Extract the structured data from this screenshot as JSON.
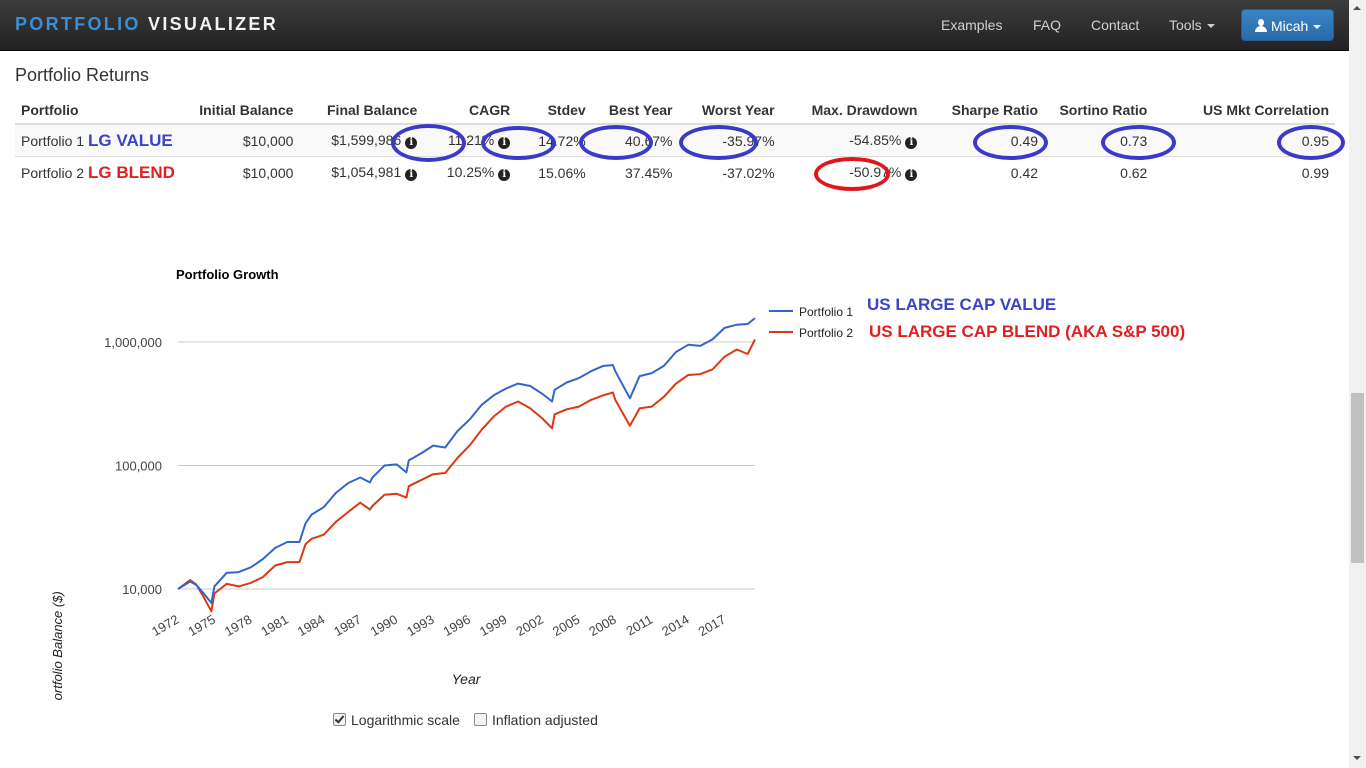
{
  "navbar": {
    "brand_part1": "PORTFOLIO",
    "brand_part2": "VISUALIZER",
    "links": [
      "Examples",
      "FAQ",
      "Contact",
      "Tools"
    ],
    "user_label": "Micah"
  },
  "section_title": "Portfolio Returns",
  "table": {
    "headers": [
      "Portfolio",
      "Initial Balance",
      "Final Balance",
      "CAGR",
      "Stdev",
      "Best Year",
      "Worst Year",
      "Max. Drawdown",
      "Sharpe Ratio",
      "Sortino Ratio",
      "US Mkt Correlation"
    ],
    "rows": [
      {
        "portfolio": "Portfolio 1",
        "annotation": "LG VALUE",
        "initial": "$10,000",
        "final": "$1,599,986",
        "cagr": "11.21%",
        "stdev": "14.72%",
        "best": "40.67%",
        "worst": "-35.97%",
        "drawdown": "-54.85%",
        "sharpe": "0.49",
        "sortino": "0.73",
        "correlation": "0.95"
      },
      {
        "portfolio": "Portfolio 2",
        "annotation": "LG BLEND",
        "initial": "$10,000",
        "final": "$1,054,981",
        "cagr": "10.25%",
        "stdev": "15.06%",
        "best": "37.45%",
        "worst": "-37.02%",
        "drawdown": "-50.97%",
        "sharpe": "0.42",
        "sortino": "0.62",
        "correlation": "0.99"
      }
    ]
  },
  "legend_annotations": {
    "p1": "US LARGE CAP VALUE",
    "p2": "US LARGE CAP BLEND (AKA S&P 500)"
  },
  "controls": {
    "log_scale_label": "Logarithmic scale",
    "log_scale_checked": true,
    "inflation_label": "Inflation adjusted",
    "inflation_checked": false
  },
  "colors": {
    "series1": "#3366cc",
    "series2": "#dc3912",
    "annotation_blue": "#3b43c9",
    "annotation_red": "#e02020"
  },
  "chart_data": {
    "type": "line",
    "title": "Portfolio Growth",
    "xlabel": "Year",
    "ylabel": "Portfolio Balance ($)",
    "y_scale": "log",
    "ylim": [
      10000,
      1000000
    ],
    "y_ticks": [
      10000,
      100000,
      1000000
    ],
    "y_tick_labels": [
      "10,000",
      "100,000",
      "1,000,000"
    ],
    "x_ticks": [
      1972,
      1975,
      1978,
      1981,
      1984,
      1987,
      1990,
      1993,
      1996,
      1999,
      2002,
      2005,
      2008,
      2011,
      2014,
      2017
    ],
    "xlim": [
      1972,
      2019.5
    ],
    "grid": true,
    "legend_position": "right",
    "x": [
      1972,
      1973,
      1973.5,
      1974,
      1974.75,
      1975,
      1976,
      1977,
      1978,
      1979,
      1980,
      1981,
      1982,
      1982.5,
      1983,
      1984,
      1985,
      1986,
      1987,
      1987.8,
      1988,
      1989,
      1990,
      1990.8,
      1991,
      1992,
      1993,
      1994,
      1995,
      1996,
      1997,
      1998,
      1999,
      2000,
      2001,
      2002,
      2002.8,
      2003,
      2004,
      2005,
      2006,
      2007,
      2007.8,
      2008,
      2009.2,
      2010,
      2011,
      2012,
      2013,
      2014,
      2015,
      2016,
      2017,
      2018,
      2018.9,
      2019.5
    ],
    "series": [
      {
        "name": "Portfolio 1",
        "values": [
          10000,
          11500,
          10800,
          9500,
          7700,
          10500,
          13500,
          13700,
          15000,
          17500,
          21500,
          24000,
          24000,
          34000,
          40000,
          46000,
          60000,
          72000,
          80000,
          73000,
          80000,
          100000,
          102000,
          88000,
          110000,
          125000,
          145000,
          140000,
          190000,
          235000,
          310000,
          370000,
          420000,
          460000,
          440000,
          380000,
          330000,
          410000,
          470000,
          510000,
          580000,
          640000,
          650000,
          580000,
          350000,
          530000,
          560000,
          640000,
          830000,
          950000,
          930000,
          1050000,
          1300000,
          1380000,
          1400000,
          1560000
        ]
      },
      {
        "name": "Portfolio 2",
        "values": [
          10000,
          11800,
          10900,
          9000,
          6600,
          9200,
          11000,
          10500,
          11200,
          12500,
          15500,
          16500,
          16500,
          23000,
          25500,
          27500,
          35000,
          42000,
          50000,
          44000,
          47000,
          58000,
          59000,
          55000,
          68000,
          76000,
          85000,
          87000,
          115000,
          145000,
          195000,
          250000,
          300000,
          330000,
          290000,
          240000,
          200000,
          260000,
          285000,
          300000,
          340000,
          370000,
          390000,
          340000,
          210000,
          290000,
          300000,
          360000,
          460000,
          540000,
          550000,
          600000,
          760000,
          870000,
          800000,
          1050000
        ]
      }
    ]
  }
}
